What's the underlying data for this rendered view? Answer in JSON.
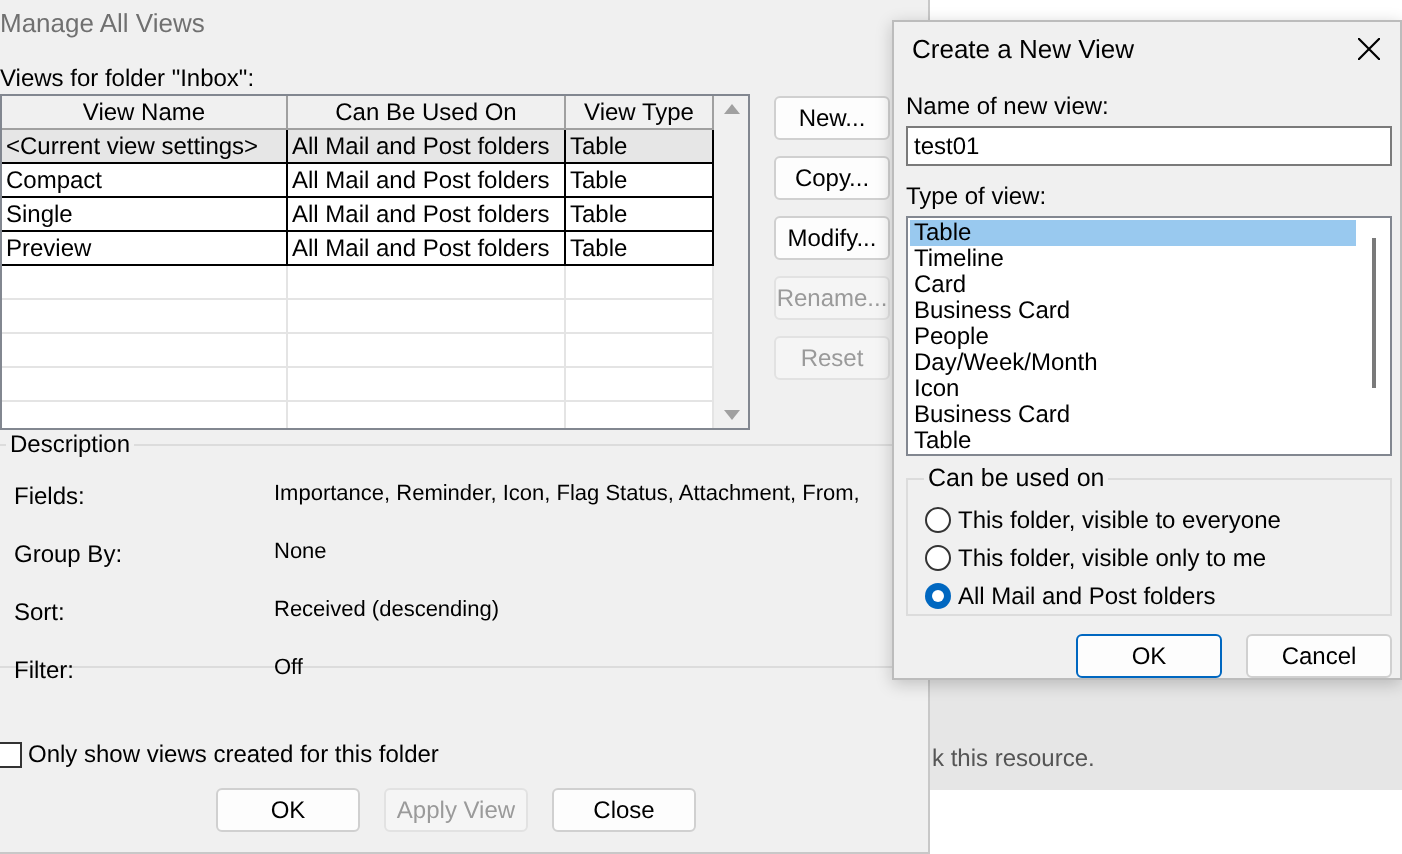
{
  "main_window": {
    "title": "Manage All Views",
    "views_label": "Views for folder \"Inbox\":",
    "table": {
      "columns": [
        "View Name",
        "Can Be Used On",
        "View Type"
      ],
      "rows": [
        {
          "cells": [
            "<Current view settings>",
            "All Mail and Post folders",
            "Table"
          ],
          "selected": true
        },
        {
          "cells": [
            "Compact",
            "All Mail and Post folders",
            "Table"
          ],
          "selected": false
        },
        {
          "cells": [
            "Single",
            "All Mail and Post folders",
            "Table"
          ],
          "selected": false
        },
        {
          "cells": [
            "Preview",
            "All Mail and Post folders",
            "Table"
          ],
          "selected": false
        }
      ]
    },
    "buttons": [
      {
        "label": "New...",
        "disabled": false
      },
      {
        "label": "Copy...",
        "disabled": false
      },
      {
        "label": "Modify...",
        "disabled": false
      },
      {
        "label": "Rename...",
        "disabled": true
      },
      {
        "label": "Reset",
        "disabled": true
      }
    ],
    "description": {
      "title": "Description",
      "fields": [
        {
          "label": "Fields:",
          "value": "Importance, Reminder, Icon, Flag Status, Attachment, From,"
        },
        {
          "label": "Group By:",
          "value": "None"
        },
        {
          "label": "Sort:",
          "value": "Received (descending)"
        },
        {
          "label": "Filter:",
          "value": "Off"
        }
      ]
    },
    "only_this_folder": {
      "label": "Only show views created for this folder",
      "checked": false
    },
    "footer_buttons": [
      {
        "label": "OK",
        "disabled": false
      },
      {
        "label": "Apply View",
        "disabled": true
      },
      {
        "label": "Close",
        "disabled": false
      }
    ]
  },
  "background_text": "k this resource.",
  "dialog": {
    "title": "Create a New View",
    "name_label": "Name of new view:",
    "name_value": "test01",
    "type_label": "Type of view:",
    "view_types": [
      {
        "label": "Table",
        "selected": true
      },
      {
        "label": "Timeline",
        "selected": false
      },
      {
        "label": "Card",
        "selected": false
      },
      {
        "label": "Business Card",
        "selected": false
      },
      {
        "label": "People",
        "selected": false
      },
      {
        "label": "Day/Week/Month",
        "selected": false
      },
      {
        "label": "Icon",
        "selected": false
      },
      {
        "label": "Business Card",
        "selected": false
      },
      {
        "label": "Table",
        "selected": false
      }
    ],
    "used_on": {
      "title": "Can be used on",
      "options": [
        {
          "label": "This folder, visible to everyone",
          "selected": false
        },
        {
          "label": "This folder, visible only to me",
          "selected": false
        },
        {
          "label": "All Mail and Post folders",
          "selected": true
        }
      ]
    },
    "buttons": [
      {
        "label": "OK",
        "default": true
      },
      {
        "label": "Cancel",
        "default": false
      }
    ]
  }
}
